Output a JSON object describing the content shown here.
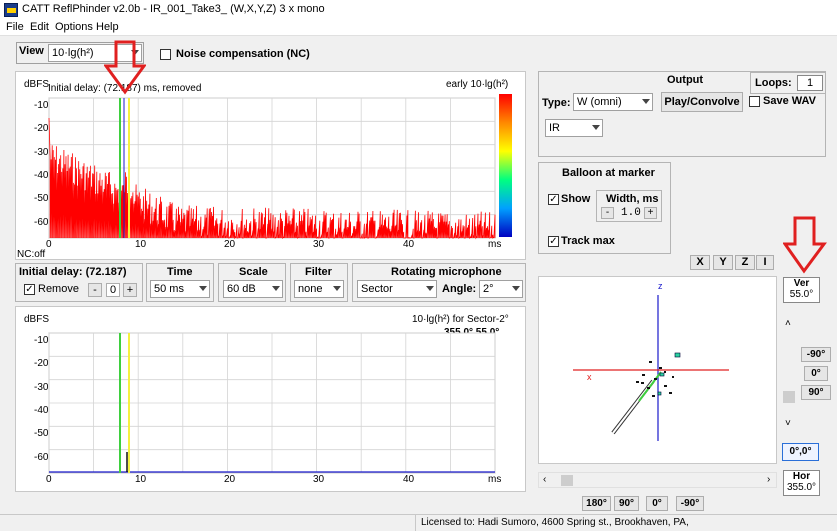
{
  "app": {
    "title": "CATT ReflPhinder v2.0b - IR_001_Take3_ (W,X,Y,Z) 3 x mono",
    "menu": [
      "File",
      "Edit",
      "Options",
      "Help"
    ]
  },
  "view": {
    "label": "View",
    "select_value": "10·lg(h²)",
    "noise_comp_label": "Noise compensation (NC)"
  },
  "top_graph": {
    "ylabel": "dBFS",
    "caption": "Initial delay: (72.187) ms, removed",
    "right_title": "early 10·lg(h²)",
    "yticks": [
      "-10",
      "-20",
      "-30",
      "-40",
      "-50",
      "-60"
    ],
    "xticks": [
      "0",
      "10",
      "20",
      "30",
      "40",
      "ms"
    ],
    "nc_text": "NC:off"
  },
  "controls": {
    "initial_delay_label": "Initial delay: (72.187)",
    "remove_label": "Remove",
    "remove_checked": "✓",
    "minus": "-",
    "zero": "0",
    "plus": "+",
    "time_label": "Time",
    "time_value": "50 ms",
    "scale_label": "Scale",
    "scale_value": "60 dB",
    "filter_label": "Filter",
    "filter_value": "none",
    "rotmic_label": "Rotating microphone",
    "rotmic_value": "Sector",
    "angle_label": "Angle:",
    "angle_value": "2°"
  },
  "bottom_graph": {
    "ylabel": "dBFS",
    "right_title": "10·lg(h²) for Sector-2°",
    "direction": "355.0° 55.0°",
    "yticks": [
      "-10",
      "-20",
      "-30",
      "-40",
      "-50",
      "-60"
    ],
    "xticks": [
      "0",
      "10",
      "20",
      "30",
      "40",
      "ms"
    ]
  },
  "output": {
    "title": "Output",
    "loops_label": "Loops:",
    "loops_value": "1",
    "type_label": "Type:",
    "type_value": "W (omni)",
    "play_button": "Play/Convolve",
    "save_wav_label": "Save WAV",
    "ir_value": "IR"
  },
  "balloon": {
    "title": "Balloon at marker",
    "show_label": "Show",
    "width_label": "Width, ms",
    "width_value": "1.0",
    "track_label": "Track max",
    "checked": "✓"
  },
  "view3d": {
    "xyz_buttons": [
      "X",
      "Y",
      "Z",
      "I"
    ],
    "ver_label": "Ver",
    "ver_value": "55.0°",
    "ver_buttons": [
      "-90°",
      "0°",
      "90°"
    ],
    "reset_button": "0°,0°",
    "hor_label": "Hor",
    "hor_value": "355.0°",
    "hor_buttons": [
      "180°",
      "90°",
      "0°",
      "-90°"
    ],
    "axis_z": "z",
    "axis_x": "x"
  },
  "status": {
    "license": "Licensed to: Hadi Sumoro, 4600 Spring st., Brookhaven, PA,"
  },
  "colors": {
    "ir_trace": "#ff0000",
    "marker_green": "#3ecf3e",
    "marker_yellow": "#f5f040",
    "annotation_red": "#e02020",
    "axis_blue": "#1a1acc"
  }
}
